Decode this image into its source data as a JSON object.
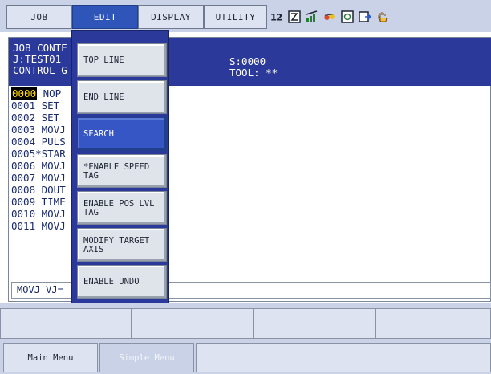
{
  "top_tabs": [
    "JOB",
    "EDIT",
    "DISPLAY",
    "UTILITY"
  ],
  "active_tab": "EDIT",
  "status_icons": [
    "tool-number-icon",
    "edit-mode-icon",
    "speed-bars-icon",
    "coordinate-icon",
    "servo-icon",
    "step-icon",
    "hand-icon"
  ],
  "job": {
    "header_line1": "JOB CONTE",
    "header_line2": "J:TEST01",
    "header_line3": "CONTROL G",
    "step_label": "S:0000",
    "tool_label": "TOOL: **"
  },
  "lines": [
    {
      "num": "0000",
      "text": " NOP",
      "selected": true
    },
    {
      "num": "0001",
      "text": " SET"
    },
    {
      "num": "0002",
      "text": " SET"
    },
    {
      "num": "0003",
      "text": " MOVJ"
    },
    {
      "num": "0004",
      "text": " PULS"
    },
    {
      "num": "0005",
      "text": "*STAR"
    },
    {
      "num": "0006",
      "text": " MOVJ"
    },
    {
      "num": "0007",
      "text": " MOVJ"
    },
    {
      "num": "0008",
      "text": " DOUT"
    },
    {
      "num": "0009",
      "text": " TIME"
    },
    {
      "num": "0010",
      "text": " MOVJ"
    },
    {
      "num": "0011",
      "text": " MOVJ"
    }
  ],
  "input_line": "MOVJ VJ=",
  "edit_menu": [
    {
      "label": "TOP LINE"
    },
    {
      "label": "END LINE"
    },
    {
      "label": "SEARCH",
      "highlight": true
    },
    {
      "label": "*ENABLE SPEED TAG"
    },
    {
      "label": "ENABLE POS LVL TAG"
    },
    {
      "label": "MODIFY TARGET AXIS"
    },
    {
      "label": "ENABLE UNDO"
    }
  ],
  "bottom": {
    "main_menu": "Main Menu",
    "simple_menu": "Simple Menu"
  },
  "colors": {
    "header_blue": "#2b3a9a",
    "highlight_blue": "#3556c4",
    "selected_yellow": "#ffd400"
  }
}
